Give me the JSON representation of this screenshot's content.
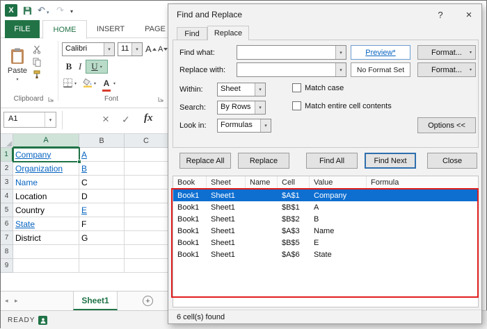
{
  "glyphs": {
    "logo": "X",
    "dropdown": "▾",
    "undo": "↶",
    "redo": "↷",
    "cancel": "×",
    "enter": "✓",
    "fx": "fx",
    "nav_left": "◂",
    "nav_right": "▸",
    "add_sheet": "+",
    "help": "?",
    "close": "×"
  },
  "colors": {
    "excel_green": "#217346",
    "hyperlink_blue": "#0563c1",
    "selection_blue": "#0e6fd1",
    "annotation_red": "#e11d1d"
  },
  "excel": {
    "ribbon_tabs": [
      "FILE",
      "HOME",
      "INSERT",
      "PAGE"
    ],
    "ribbon": {
      "paste_label": "Paste",
      "clipboard_group_label": "Clipboard",
      "font_group_label": "Font",
      "font_name": "Calibri",
      "font_size": "11",
      "bold_label": "B",
      "italic_label": "I",
      "underline_label": "U",
      "grow_font_label": "A",
      "shrink_font_label": "A",
      "font_color_label": "A"
    },
    "formula_bar": {
      "name_box": "A1"
    },
    "grid": {
      "columns": [
        "A",
        "B",
        "C"
      ],
      "rows": [
        {
          "num": "1",
          "num_state": "selhead",
          "a": "Company",
          "a_style": "link",
          "b": "A",
          "b_style": "link"
        },
        {
          "num": "2",
          "a": "Organization",
          "a_style": "link",
          "b": "B",
          "b_style": "link"
        },
        {
          "num": "3",
          "a": "Name",
          "a_style": "blue",
          "b": "C",
          "b_style": "plain"
        },
        {
          "num": "4",
          "a": "Location",
          "a_style": "plain",
          "b": "D",
          "b_style": "plain"
        },
        {
          "num": "5",
          "a": "Country",
          "a_style": "plain",
          "b": "E",
          "b_style": "link"
        },
        {
          "num": "6",
          "a": "State",
          "a_style": "link",
          "b": "F",
          "b_style": "plain"
        },
        {
          "num": "7",
          "a": "District",
          "a_style": "plain",
          "b": "G",
          "b_style": "plain"
        },
        {
          "num": "8",
          "a": "",
          "b": ""
        },
        {
          "num": "9",
          "a": "",
          "b": ""
        }
      ]
    },
    "sheet_tab": "Sheet1",
    "status": "READY"
  },
  "dialog": {
    "title": "Find and Replace",
    "tabs": [
      "Find",
      "Replace"
    ],
    "active_tab": "Replace",
    "fields": {
      "find_what_label": "Find what:",
      "find_what_value": "",
      "replace_with_label": "Replace with:",
      "replace_with_value": "",
      "preview_label": "Preview*",
      "no_format_label": "No Format Set",
      "format_label": "Format...",
      "within_label": "Within:",
      "within_value": "Sheet",
      "search_label": "Search:",
      "search_value": "By Rows",
      "look_in_label": "Look in:",
      "look_in_value": "Formulas",
      "match_case_label": "Match case",
      "match_entire_label": "Match entire cell contents",
      "options_label": "Options <<"
    },
    "buttons": {
      "replace_all": "Replace All",
      "replace": "Replace",
      "find_all": "Find All",
      "find_next": "Find Next",
      "close": "Close"
    },
    "results": {
      "columns": [
        "Book",
        "Sheet",
        "Name",
        "Cell",
        "Value",
        "Formula"
      ],
      "rows": [
        {
          "state": "selected",
          "book": "Book1",
          "sheet": "Sheet1",
          "name": "",
          "cell": "$A$1",
          "value": "Company",
          "formula": ""
        },
        {
          "state": "",
          "book": "Book1",
          "sheet": "Sheet1",
          "name": "",
          "cell": "$B$1",
          "value": "A",
          "formula": ""
        },
        {
          "state": "",
          "book": "Book1",
          "sheet": "Sheet1",
          "name": "",
          "cell": "$B$2",
          "value": "B",
          "formula": ""
        },
        {
          "state": "",
          "book": "Book1",
          "sheet": "Sheet1",
          "name": "",
          "cell": "$A$3",
          "value": "Name",
          "formula": ""
        },
        {
          "state": "",
          "book": "Book1",
          "sheet": "Sheet1",
          "name": "",
          "cell": "$B$5",
          "value": "E",
          "formula": ""
        },
        {
          "state": "",
          "book": "Book1",
          "sheet": "Sheet1",
          "name": "",
          "cell": "$A$6",
          "value": "State",
          "formula": ""
        }
      ]
    },
    "status": "6 cell(s) found"
  }
}
